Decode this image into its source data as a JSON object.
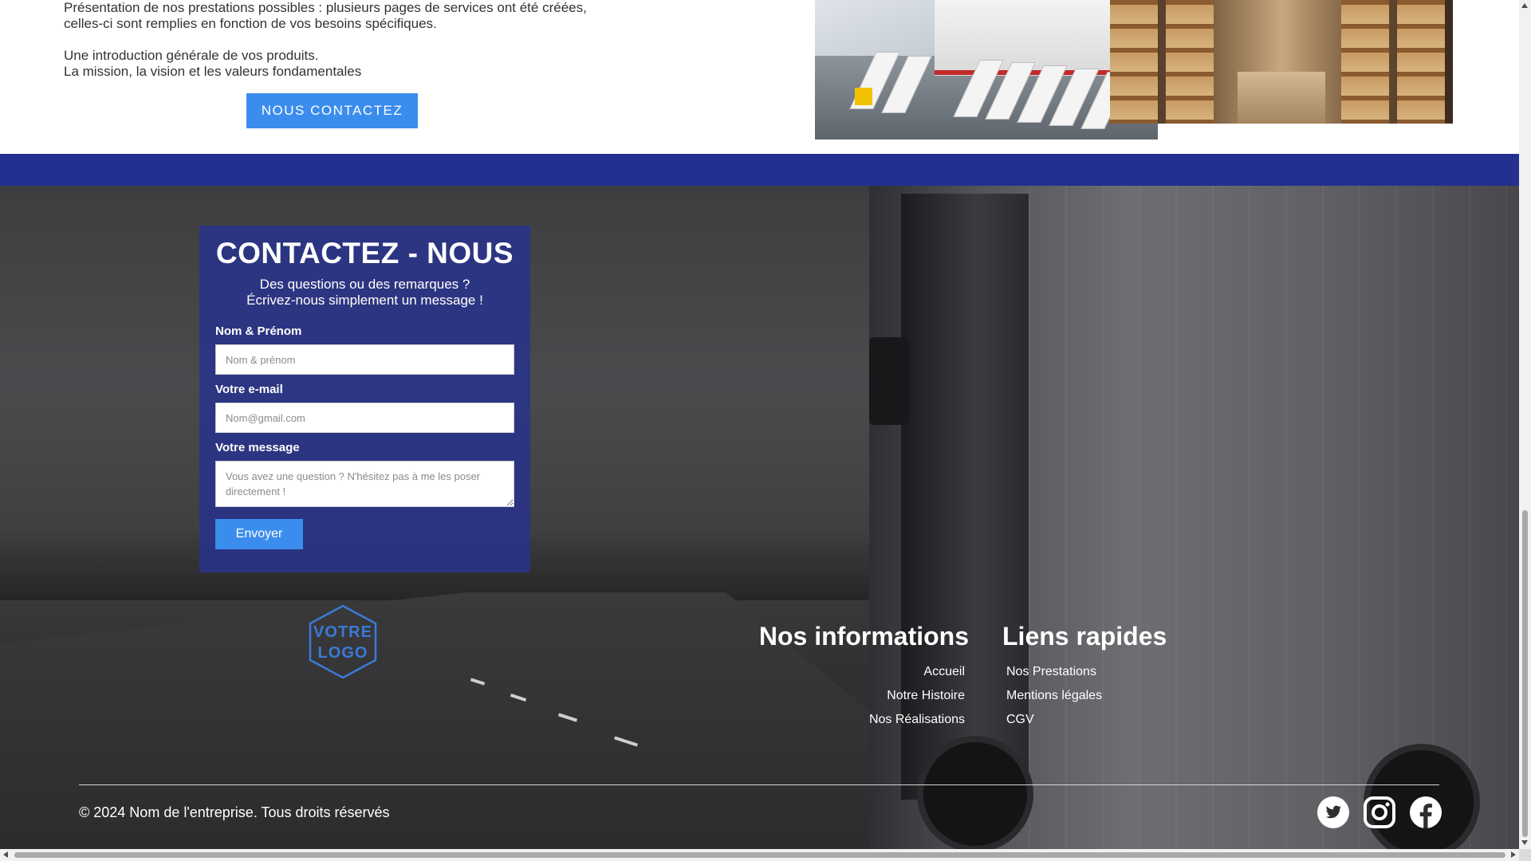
{
  "intro": {
    "line1": "Présentation de nos prestations possibles : plusieurs pages de services ont été créées,",
    "line2": "celles-ci sont remplies en fonction de vos besoins spécifiques.",
    "line3": "Une introduction générale de vos produits.",
    "line4": "La mission, la vision et les valeurs fondamentales",
    "cta_label": "NOUS CONTACTEZ"
  },
  "contact": {
    "title": "CONTACTEZ - NOUS",
    "subtitle_line1": "Des questions ou des remarques ?",
    "subtitle_line2": "Écrivez-nous simplement un message !",
    "name_label": "Nom & Prénom",
    "name_placeholder": "Nom & prénom",
    "email_label": "Votre e-mail",
    "email_placeholder": "Nom@gmail.com",
    "message_label": "Votre message",
    "message_placeholder": "Vous avez une question ? N'hésitez pas à me les poser directement !",
    "send_label": "Envoyer"
  },
  "logo": {
    "line1": "VOTRE",
    "line2": "LOGO"
  },
  "footer": {
    "info_title": "Nos informations",
    "info_links": [
      "Accueil",
      "Notre Histoire",
      "Nos Réalisations"
    ],
    "links_title": "Liens rapides",
    "quick_links": [
      "Nos Prestations",
      "Mentions légales",
      "CGV"
    ],
    "copyright": "© 2024 Nom de l'entreprise. Tous droits réservés",
    "socials": [
      "twitter-icon",
      "instagram-icon",
      "facebook-icon"
    ]
  },
  "colors": {
    "accent_button": "#3b8ded",
    "band_blue": "#23308f",
    "panel_blue": "#28328c",
    "logo_blue": "#3a7ad8"
  }
}
